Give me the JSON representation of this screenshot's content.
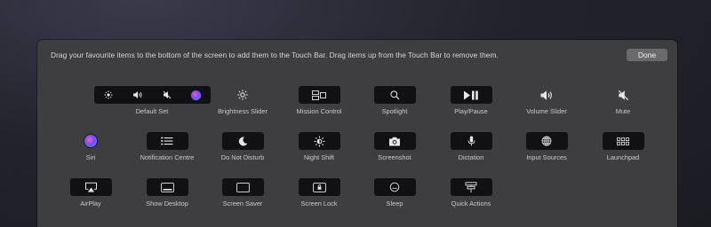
{
  "instructions": "Drag your favourite items to the bottom of the screen to add them to the Touch Bar. Drag items up from the Touch Bar to remove them.",
  "done_label": "Done",
  "colors": {
    "panel": "#3e3e41",
    "key": "#111113",
    "done_button": "#6a6a6d"
  },
  "items": [
    {
      "label": "Default Set",
      "icons": [
        "brightness-icon",
        "volume-icon",
        "mute-icon",
        "siri-icon"
      ]
    },
    {
      "label": "Brightness Slider",
      "icon": "brightness-icon"
    },
    {
      "label": "Mission Control",
      "icon": "mission-control-icon"
    },
    {
      "label": "Spotlight",
      "icon": "magnifier-icon"
    },
    {
      "label": "Play/Pause",
      "icon": "play-pause-icon"
    },
    {
      "label": "Volume Slider",
      "icon": "volume-icon"
    },
    {
      "label": "Mute",
      "icon": "mute-icon"
    },
    {
      "label": "Siri",
      "icon": "siri-icon"
    },
    {
      "label": "Notification Centre",
      "icon": "list-icon"
    },
    {
      "label": "Do Not Disturb",
      "icon": "moon-icon"
    },
    {
      "label": "Night Shift",
      "icon": "night-shift-icon"
    },
    {
      "label": "Screenshot",
      "icon": "camera-icon"
    },
    {
      "label": "Dictation",
      "icon": "microphone-icon"
    },
    {
      "label": "Input Sources",
      "icon": "globe-icon"
    },
    {
      "label": "Launchpad",
      "icon": "grid-icon"
    },
    {
      "label": "AirPlay",
      "icon": "airplay-icon"
    },
    {
      "label": "Show Desktop",
      "icon": "desktop-icon"
    },
    {
      "label": "Screen Saver",
      "icon": "screen-icon"
    },
    {
      "label": "Screen Lock",
      "icon": "lock-screen-icon"
    },
    {
      "label": "Sleep",
      "icon": "sleep-icon"
    },
    {
      "label": "Quick Actions",
      "icon": "quick-actions-icon"
    }
  ]
}
